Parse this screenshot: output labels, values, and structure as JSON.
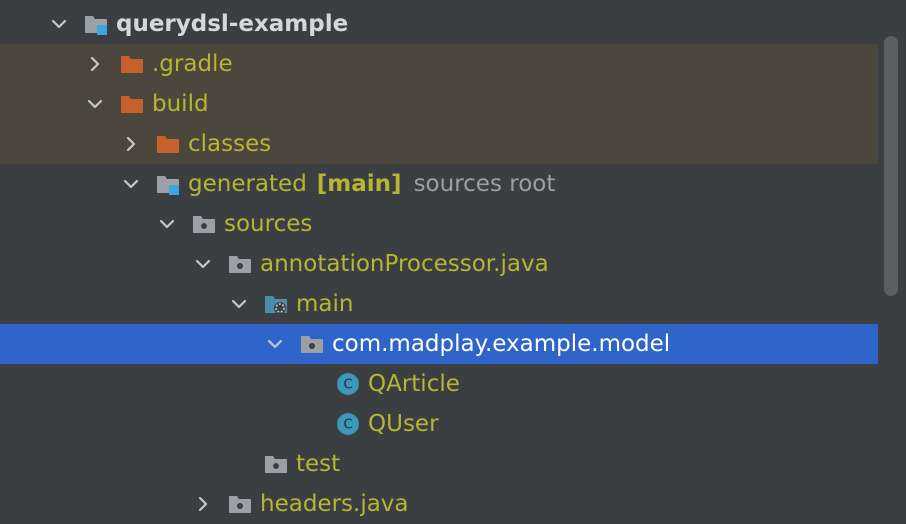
{
  "colors": {
    "background": "#3c3f41",
    "excluded_row_background": "#4c473c",
    "selection_background": "#2f65ca",
    "label_color": "#b6b634",
    "folder_orange": "#c7622f",
    "folder_gray": "#9aa0a6",
    "class_icon": "#3d97b9"
  },
  "tree": [
    {
      "label": "querydsl-example",
      "arrow": "expanded",
      "icon": "module-folder-icon",
      "indent": 0,
      "style": "plain",
      "excluded": false,
      "selected": false
    },
    {
      "label": ".gradle",
      "arrow": "collapsed",
      "icon": "excluded-folder-icon",
      "indent": 1,
      "style": "vcs",
      "excluded": true,
      "selected": false
    },
    {
      "label": "build",
      "arrow": "expanded",
      "icon": "excluded-folder-icon",
      "indent": 1,
      "style": "vcs",
      "excluded": true,
      "selected": false
    },
    {
      "label": "classes",
      "arrow": "collapsed",
      "icon": "excluded-folder-icon",
      "indent": 2,
      "style": "vcs",
      "excluded": true,
      "selected": false
    },
    {
      "label": "generated",
      "tag": "[main]",
      "hint": "sources root",
      "arrow": "expanded",
      "icon": "module-folder-icon",
      "indent": 2,
      "style": "vcs",
      "excluded": false,
      "selected": false
    },
    {
      "label": "sources",
      "arrow": "expanded",
      "icon": "package-folder-icon",
      "indent": 3,
      "style": "vcs",
      "excluded": false,
      "selected": false
    },
    {
      "label": "annotationProcessor.java",
      "arrow": "expanded",
      "icon": "package-folder-icon",
      "indent": 4,
      "style": "vcs",
      "excluded": false,
      "selected": false
    },
    {
      "label": "main",
      "arrow": "expanded",
      "icon": "generated-source-folder-icon",
      "indent": 5,
      "style": "vcs",
      "excluded": false,
      "selected": false
    },
    {
      "label": "com.madplay.example.model",
      "arrow": "expanded",
      "icon": "package-folder-icon",
      "indent": 6,
      "style": "vcs",
      "excluded": false,
      "selected": true
    },
    {
      "label": "QArticle",
      "arrow": "none",
      "icon": "class-icon",
      "indent": 7,
      "style": "vcs",
      "excluded": false,
      "selected": false
    },
    {
      "label": "QUser",
      "arrow": "none",
      "icon": "class-icon",
      "indent": 7,
      "style": "vcs",
      "excluded": false,
      "selected": false
    },
    {
      "label": "test",
      "arrow": "none",
      "icon": "package-folder-icon",
      "indent": 5,
      "style": "vcs",
      "excluded": false,
      "selected": false
    },
    {
      "label": "headers.java",
      "arrow": "collapsed",
      "icon": "package-folder-icon",
      "indent": 4,
      "style": "vcs",
      "excluded": false,
      "selected": false
    }
  ]
}
